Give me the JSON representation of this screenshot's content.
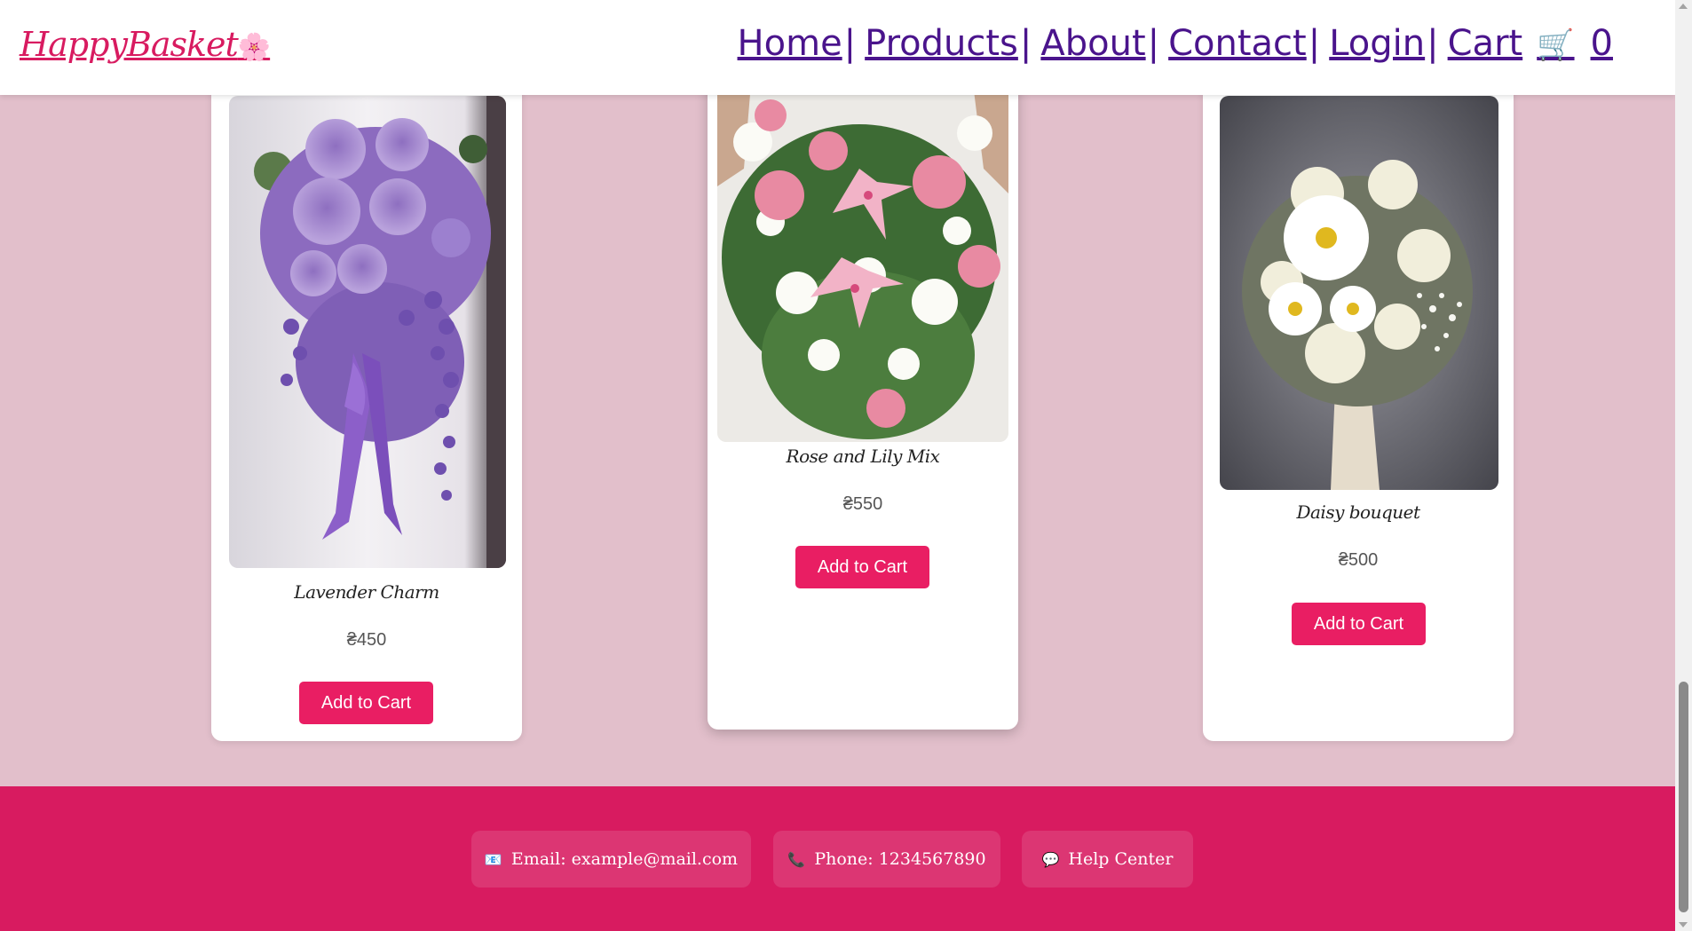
{
  "header": {
    "logo_text": "HappyBasket",
    "logo_flower": "🌸",
    "nav": {
      "home": "Home",
      "products": "Products",
      "about": "About",
      "contact": "Contact",
      "login": "Login",
      "cart": "Cart",
      "cart_icon": "🛒",
      "cart_count": "0",
      "separator": "|"
    }
  },
  "products": [
    {
      "name": "Lavender Charm",
      "price": "₴450",
      "button": "Add to Cart"
    },
    {
      "name": "Rose and Lily Mix",
      "price": "₴550",
      "button": "Add to Cart"
    },
    {
      "name": "Daisy bouquet",
      "price": "₴500",
      "button": "Add to Cart"
    }
  ],
  "footer": {
    "email": "Email: example@mail.com",
    "email_icon": "📧",
    "phone": "Phone: 1234567890",
    "phone_icon": "📞",
    "help": "Help Center",
    "help_icon": "💬"
  },
  "colors": {
    "brand": "#d81b60",
    "button": "#e91e63",
    "nav_link": "#4a148c",
    "page_background": "#e2bfcb"
  }
}
